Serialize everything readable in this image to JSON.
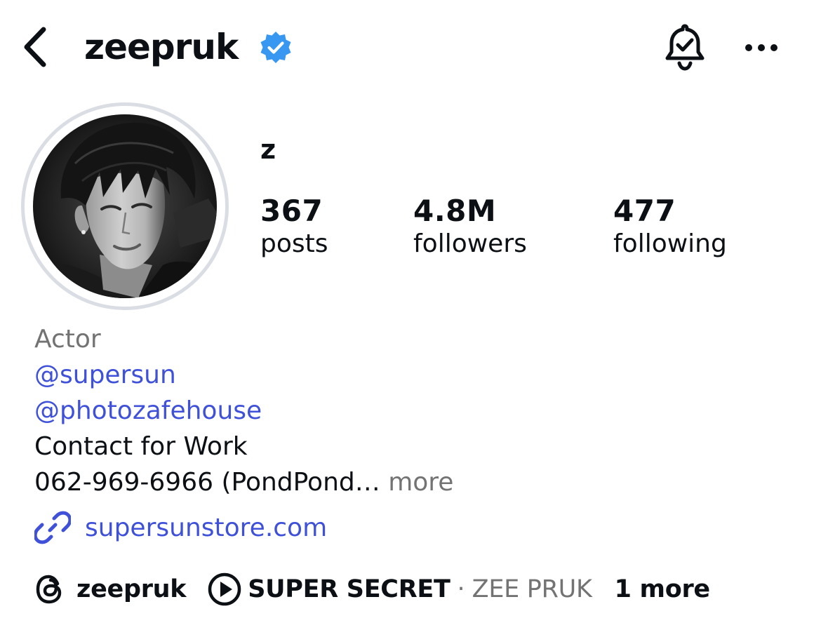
{
  "header": {
    "username": "zeepruk",
    "verified": true,
    "icons": {
      "back": "chevron-left-icon",
      "verified": "verified-badge-icon",
      "notifications": "bell-check-icon",
      "more": "more-horizontal-icon"
    }
  },
  "profile": {
    "display_name": "z",
    "stats": [
      {
        "value": "367",
        "label": "posts"
      },
      {
        "value": "4.8M",
        "label": "followers"
      },
      {
        "value": "477",
        "label": "following"
      }
    ]
  },
  "bio": {
    "category": "Actor",
    "mentions": [
      "@supersun",
      "@photozafehouse"
    ],
    "line_contact": "Contact for Work",
    "line_phone": "062-969-6966 (PondPond…",
    "more_label": "more"
  },
  "link": {
    "text": "supersunstore.com",
    "icon": "link-icon"
  },
  "bottom_row": {
    "threads_handle": "zeepruk",
    "music_title": "SUPER SECRET",
    "separator": "·",
    "music_artist": "ZEE PRUK",
    "more_label": "1 more"
  },
  "colors": {
    "verified": "#3897f0",
    "link": "#3f51d9",
    "secondary": "#737373",
    "avatar_ring": "#dadde3"
  }
}
